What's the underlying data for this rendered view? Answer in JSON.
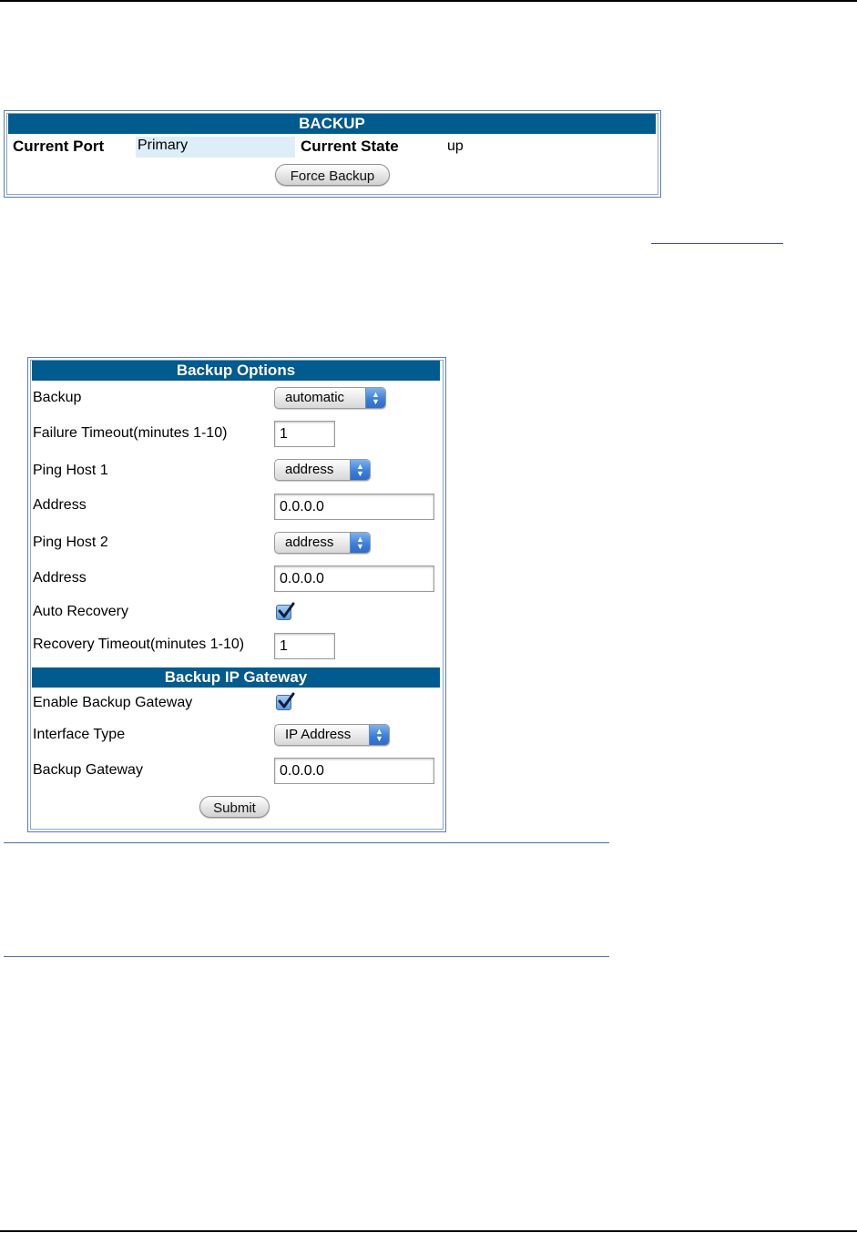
{
  "backup_panel": {
    "title": "BACKUP",
    "current_port_label": "Current Port",
    "current_port_value": "Primary",
    "current_state_label": "Current State",
    "current_state_value": "up",
    "force_backup_button": "Force Backup"
  },
  "backup_options": {
    "title": "Backup Options",
    "backup_label": "Backup",
    "backup_value": "automatic",
    "failure_timeout_label": "Failure Timeout(minutes 1-10)",
    "failure_timeout_value": "1",
    "ping_host1_label": "Ping Host 1",
    "ping_host1_value": "address",
    "address1_label": "Address",
    "address1_value": "0.0.0.0",
    "ping_host2_label": "Ping Host 2",
    "ping_host2_value": "address",
    "address2_label": "Address",
    "address2_value": "0.0.0.0",
    "auto_recovery_label": "Auto Recovery",
    "auto_recovery_checked": true,
    "recovery_timeout_label": "Recovery Timeout(minutes 1-10)",
    "recovery_timeout_value": "1"
  },
  "backup_gateway": {
    "title": "Backup IP Gateway",
    "enable_label": "Enable Backup Gateway",
    "enable_checked": true,
    "interface_type_label": "Interface Type",
    "interface_type_value": "IP Address",
    "gateway_label": "Backup Gateway",
    "gateway_value": "0.0.0.0",
    "submit_button": "Submit"
  },
  "colors": {
    "header_bg": "#005b8e",
    "primary_cell_bg": "#ddeef8",
    "link": "#3949c9"
  }
}
